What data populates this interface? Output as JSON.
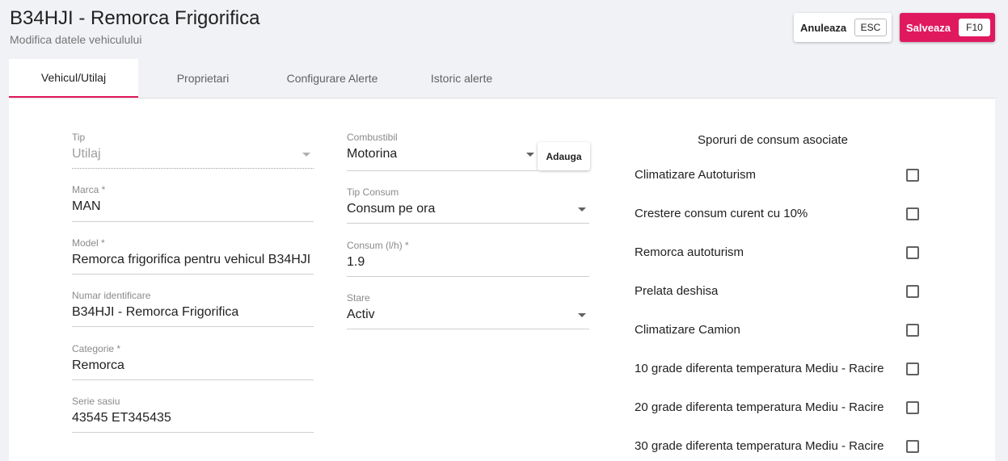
{
  "header": {
    "title": "B34HJI - Remorca Frigorifica",
    "subtitle": "Modifica datele vehiculului",
    "cancel": {
      "label": "Anuleaza",
      "key": "ESC"
    },
    "save": {
      "label": "Salveaza",
      "key": "F10"
    }
  },
  "tabs": [
    {
      "label": "Vehicul/Utilaj",
      "active": true
    },
    {
      "label": "Proprietari"
    },
    {
      "label": "Configurare Alerte"
    },
    {
      "label": "Istoric alerte"
    }
  ],
  "form": {
    "tip": {
      "label": "Tip",
      "value": "Utilaj"
    },
    "marca": {
      "label": "Marca *",
      "value": "MAN"
    },
    "model": {
      "label": "Model *",
      "value": "Remorca frigorifica pentru vehicul B34HJI"
    },
    "numar": {
      "label": "Numar identificare",
      "value": "B34HJI - Remorca Frigorifica"
    },
    "categorie": {
      "label": "Categorie *",
      "value": "Remorca"
    },
    "serie": {
      "label": "Serie sasiu",
      "value": "43545 ET345435"
    },
    "combustibil": {
      "label": "Combustibil",
      "value": "Motorina"
    },
    "tip_consum": {
      "label": "Tip Consum",
      "value": "Consum pe ora"
    },
    "consum": {
      "label": "Consum (l/h) *",
      "value": "1.9"
    },
    "stare": {
      "label": "Stare",
      "value": "Activ"
    },
    "add_label": "Adauga"
  },
  "sporuri": {
    "title": "Sporuri de consum asociate",
    "items": [
      {
        "label": "Climatizare Autoturism",
        "checked": false
      },
      {
        "label": "Crestere consum curent cu 10%",
        "checked": false
      },
      {
        "label": "Remorca autoturism",
        "checked": false
      },
      {
        "label": "Prelata deshisa",
        "checked": false
      },
      {
        "label": "Climatizare Camion",
        "checked": false
      },
      {
        "label": "10 grade diferenta temperatura Mediu - Racire",
        "checked": false
      },
      {
        "label": "20 grade diferenta temperatura Mediu - Racire",
        "checked": false
      },
      {
        "label": "30 grade diferenta temperatura Mediu - Racire",
        "checked": false
      }
    ]
  },
  "colors": {
    "accent": "#e0195f",
    "background": "#f0f2f5",
    "panel": "#ffffff"
  }
}
